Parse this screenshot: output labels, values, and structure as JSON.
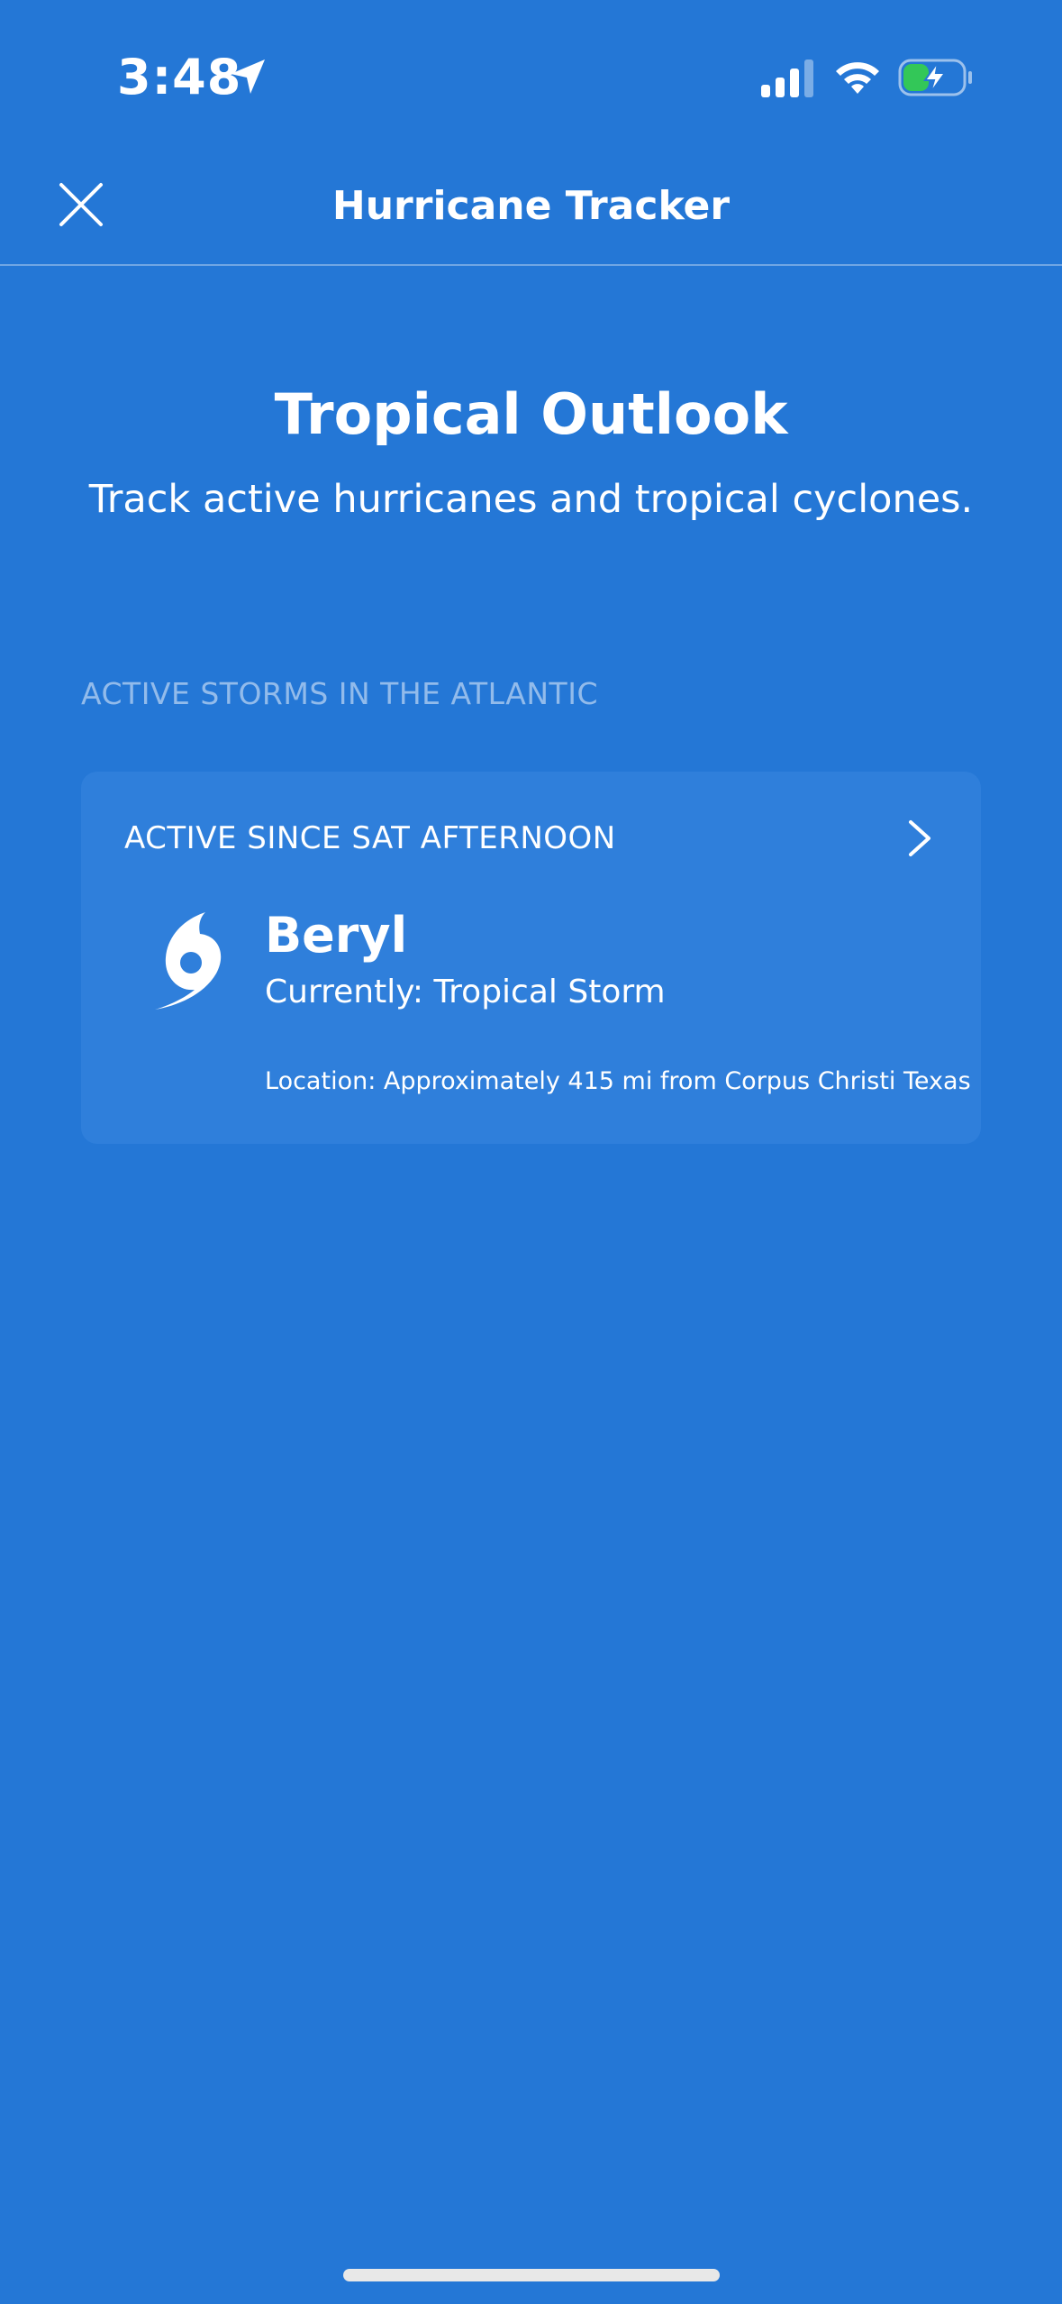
{
  "status_bar": {
    "time": "3:48",
    "icons": [
      "location-arrow-icon",
      "cellular-signal-icon",
      "wifi-icon",
      "battery-charging-icon"
    ]
  },
  "nav": {
    "title": "Hurricane Tracker",
    "close_icon": "close-icon"
  },
  "hero": {
    "title": "Tropical Outlook",
    "subtitle": "Track active hurricanes and tropical cyclones."
  },
  "section": {
    "header": "ACTIVE STORMS IN THE ATLANTIC"
  },
  "storms": [
    {
      "active_since": "ACTIVE SINCE SAT AFTERNOON",
      "name": "Beryl",
      "status": "Currently: Tropical Storm",
      "location": "Location: Approximately 415 mi from Corpus Christi Texas",
      "icon": "tropical-storm-icon"
    }
  ],
  "colors": {
    "background": "#2477d6",
    "card": "#2f7fdb",
    "text": "#ffffff",
    "battery_fill": "#33c758"
  }
}
